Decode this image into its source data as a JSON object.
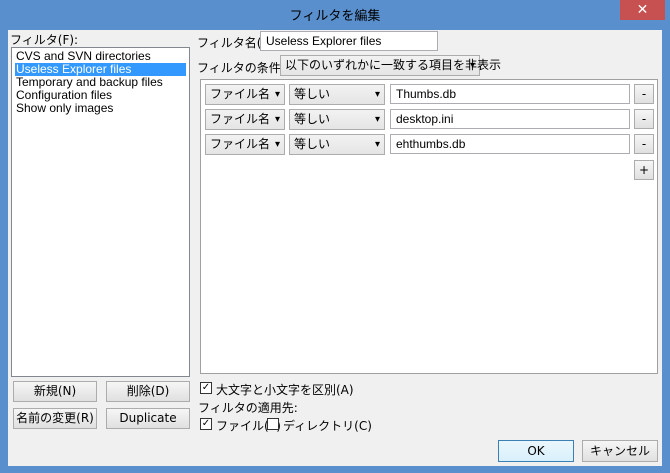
{
  "window": {
    "title": "フィルタを編集",
    "close_glyph": "✕"
  },
  "filters_panel": {
    "label": "フィルタ(F):",
    "items": [
      {
        "label": "CVS and SVN directories",
        "selected": false
      },
      {
        "label": "Useless Explorer files",
        "selected": true
      },
      {
        "label": "Temporary and backup files",
        "selected": false
      },
      {
        "label": "Configuration files",
        "selected": false
      },
      {
        "label": "Show only images",
        "selected": false
      }
    ],
    "buttons": {
      "new": "新規(N)",
      "delete": "削除(D)",
      "rename": "名前の変更(R)",
      "duplicate": "Duplicate"
    }
  },
  "filter_name": {
    "label": "フィルタ名(I):",
    "value": "Useless Explorer files"
  },
  "filter_condition": {
    "label": "フィルタの条件(F):",
    "value": "以下のいずれかに一致する項目を非表示"
  },
  "rules": [
    {
      "field": "ファイル名",
      "operator": "等しい",
      "value": "Thumbs.db",
      "remove": "-"
    },
    {
      "field": "ファイル名",
      "operator": "等しい",
      "value": "desktop.ini",
      "remove": "-"
    },
    {
      "field": "ファイル名",
      "operator": "等しい",
      "value": "ehthumbs.db",
      "remove": "-"
    }
  ],
  "add_rule": "+",
  "options": {
    "case_sensitive": {
      "label": "大文字と小文字を区別(A)",
      "checked": true
    },
    "apply_to_label": "フィルタの適用先:",
    "apply_files": {
      "label": "ファイル(E)",
      "checked": true
    },
    "apply_dirs": {
      "label": "ディレクトリ(C)",
      "checked": false
    }
  },
  "footer": {
    "ok": "OK",
    "cancel": "キャンセル"
  },
  "icons": {
    "dropdown": "chevron-down-icon",
    "check": "checkmark-icon"
  },
  "colors": {
    "titlebar": "#5a8fce",
    "close": "#c75050",
    "selection": "#3399ff"
  }
}
